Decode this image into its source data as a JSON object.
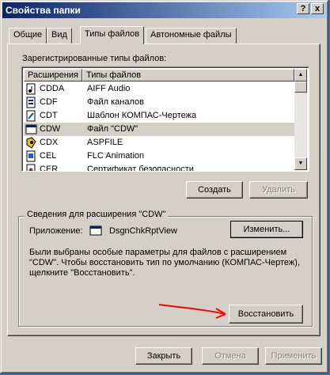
{
  "window": {
    "title": "Свойства папки",
    "help_btn": "?",
    "close_btn": "x"
  },
  "tabs": [
    {
      "label": "Общие"
    },
    {
      "label": "Вид"
    },
    {
      "label": "Типы файлов"
    },
    {
      "label": "Автономные файлы"
    }
  ],
  "registered_label": "Зарегистрированные типы файлов:",
  "columns": {
    "ext": "Расширения",
    "type": "Типы файлов"
  },
  "rows": [
    {
      "ext": "CDDA",
      "type": "AIFF Audio"
    },
    {
      "ext": "CDF",
      "type": "Файл каналов"
    },
    {
      "ext": "CDT",
      "type": "Шаблон КОМПАС-Чертежа"
    },
    {
      "ext": "CDW",
      "type": "Файл \"CDW\""
    },
    {
      "ext": "CDX",
      "type": "ASPFILE"
    },
    {
      "ext": "CEL",
      "type": "FLC Animation"
    },
    {
      "ext": "CER",
      "type": "Сертификат безопасности"
    }
  ],
  "buttons": {
    "create": "Создать",
    "delete": "Удалить",
    "change": "Изменить...",
    "restore": "Восстановить",
    "close": "Закрыть",
    "cancel": "Отмена",
    "apply": "Применить"
  },
  "details": {
    "group_label": "Сведения для расширения \"CDW\"",
    "app_label": "Приложение:",
    "app_name": "DsgnChkRptView",
    "description": "Были выбраны особые параметры для файлов с расширением \"CDW\". Чтобы восстановить тип по умолчанию (КОМПАС-Чертеж), щелкните \"Восстановить\"."
  },
  "colors": {
    "titlebar": "#0a246a",
    "face": "#d4d0c8",
    "annotation_arrow": "#ff0000"
  }
}
